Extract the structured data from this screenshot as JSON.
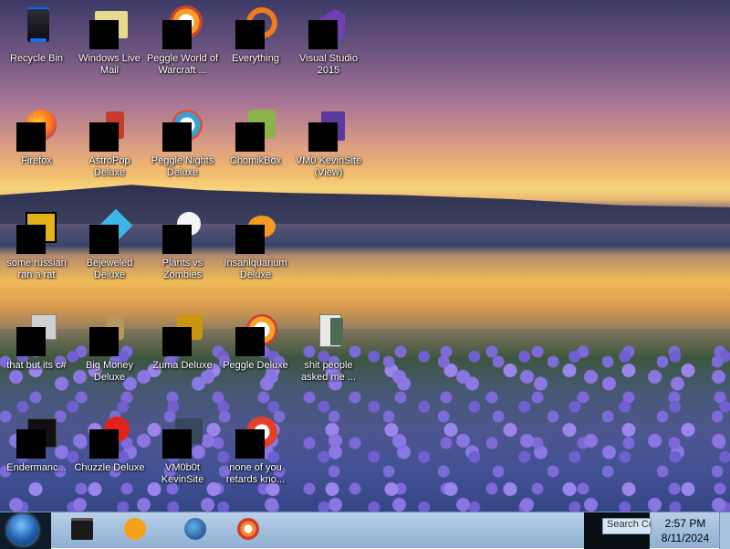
{
  "desktop": {
    "icons": [
      {
        "label": "Recycle Bin",
        "icon": "recycle-bin-icon"
      },
      {
        "label": "Windows Live Mail",
        "icon": "mail-icon"
      },
      {
        "label": "Peggle World of Warcraft ...",
        "icon": "peggle-icon"
      },
      {
        "label": "Everything",
        "icon": "search-icon"
      },
      {
        "label": "Visual Studio 2015",
        "icon": "visual-studio-icon"
      },
      {
        "label": "Firefox",
        "icon": "firefox-icon"
      },
      {
        "label": "AstroPop Deluxe",
        "icon": "game-icon"
      },
      {
        "label": "Peggle Nights Deluxe",
        "icon": "peggle-icon"
      },
      {
        "label": "ChomikBox",
        "icon": "chomikbox-icon"
      },
      {
        "label": "VM0 KevinSite (View)",
        "icon": "file-icon"
      },
      {
        "label": "some russian ran a rat",
        "icon": "app-icon"
      },
      {
        "label": "Bejeweled Deluxe",
        "icon": "gem-icon"
      },
      {
        "label": "Plants vs Zombies",
        "icon": "game-icon"
      },
      {
        "label": "Insaniquarium Deluxe",
        "icon": "fish-icon"
      },
      {
        "label": "that but its c#",
        "icon": "folder-icon"
      },
      {
        "label": "Big Money Deluxe",
        "icon": "game-icon"
      },
      {
        "label": "Zuma Deluxe",
        "icon": "game-icon"
      },
      {
        "label": "Peggle Deluxe",
        "icon": "peggle-icon"
      },
      {
        "label": "shit people asked me ...",
        "icon": "document-icon"
      },
      {
        "label": "Endermanc...",
        "icon": "app-icon"
      },
      {
        "label": "Chuzzle Deluxe",
        "icon": "game-icon"
      },
      {
        "label": "VM0b0t KevinSite",
        "icon": "app-icon"
      },
      {
        "label": "none of you retards kno...",
        "icon": "app-icon"
      }
    ]
  },
  "taskbar": {
    "start_icon": "windows-orb-icon",
    "pinned": [
      {
        "icon": "terminal-icon"
      },
      {
        "icon": "media-player-icon"
      },
      {
        "icon": "globe-icon"
      },
      {
        "icon": "paint-icon"
      }
    ],
    "search_text": "Search Co",
    "clock": {
      "time": "2:57 PM",
      "date": "8/11/2024"
    }
  }
}
